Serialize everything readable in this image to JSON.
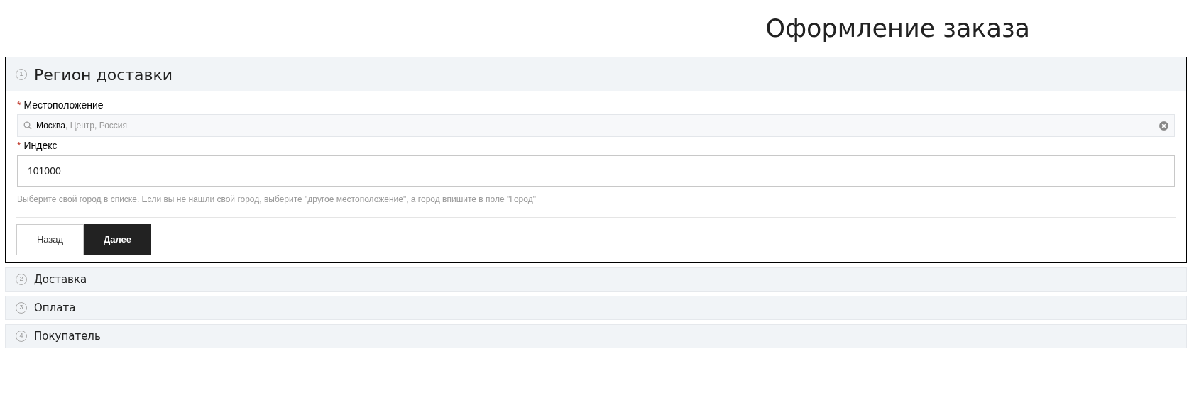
{
  "title": "Оформление заказа",
  "sections": [
    {
      "number": "1",
      "title": "Регион доставки",
      "expanded": true
    },
    {
      "number": "2",
      "title": "Доставка",
      "expanded": false
    },
    {
      "number": "3",
      "title": "Оплата",
      "expanded": false
    },
    {
      "number": "4",
      "title": "Покупатель",
      "expanded": false
    }
  ],
  "region_form": {
    "location": {
      "label": "Местоположение",
      "required_mark": "*",
      "city": "Москва",
      "details": ", Центр, Россия"
    },
    "postcode": {
      "label": "Индекс",
      "required_mark": "*",
      "value": "101000"
    },
    "hint": "Выберите свой город в списке. Если вы не нашли свой город, выберите \"другое местоположение\", а город впишите в поле \"Город\"",
    "buttons": [
      {
        "label": "Назад",
        "kind": "secondary"
      },
      {
        "label": "Далее",
        "kind": "primary"
      }
    ]
  }
}
